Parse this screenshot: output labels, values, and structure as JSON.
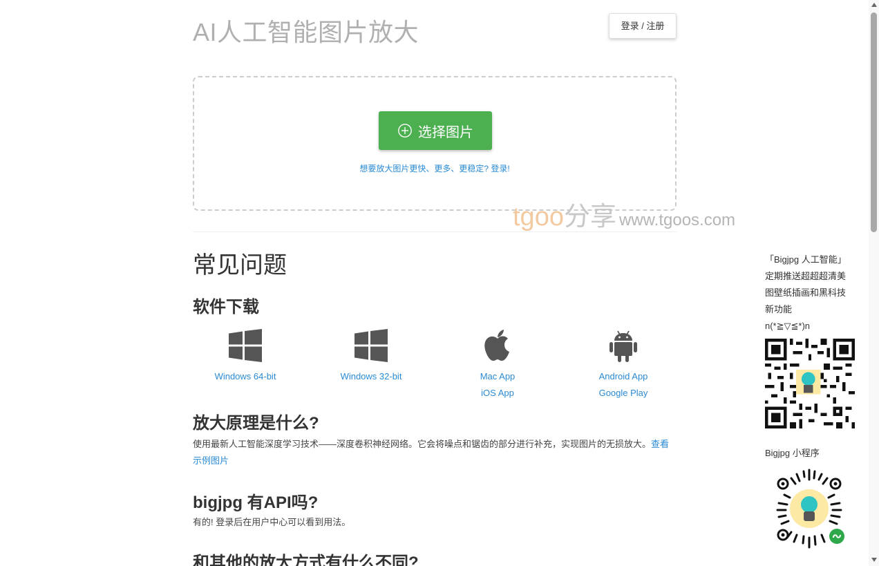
{
  "header": {
    "title": "AI人工智能图片放大",
    "login_label": "登录 / 注册"
  },
  "upload": {
    "choose_label": "选择图片",
    "upgrade_text": "想要放大图片更快、更多、更稳定? 登录!"
  },
  "watermark": {
    "logo": "tgoo",
    "text": "分享",
    "url": "www.tgoos.com"
  },
  "faq": {
    "title": "常见问题",
    "download_title": "软件下载",
    "downloads": [
      {
        "icon": "windows-icon",
        "links": [
          "Windows 64-bit"
        ]
      },
      {
        "icon": "windows-icon",
        "links": [
          "Windows 32-bit"
        ]
      },
      {
        "icon": "apple-icon",
        "links": [
          "Mac App",
          "iOS App"
        ]
      },
      {
        "icon": "android-icon",
        "links": [
          "Android App",
          "Google Play"
        ]
      }
    ],
    "q1_title": "放大原理是什么?",
    "q1_text": "使用最新人工智能深度学习技术——深度卷积神经网络。它会将噪点和锯齿的部分进行补充，实现图片的无损放大。",
    "q1_link": "查看示例图片",
    "q2_title": "bigjpg 有API吗?",
    "q2_text": "有的! 登录后在用户中心可以看到用法。",
    "q3_title": "和其他的放大方式有什么不同?"
  },
  "sidebar": {
    "lines": [
      "「Bigjpg 人工智能」",
      "定期推送超超超清美",
      "图壁纸插画和黑科技",
      "新功能",
      "n(*≧▽≦*)n"
    ],
    "mini_program_title": "Bigjpg 小程序"
  },
  "colors": {
    "accent_green": "#4caf50",
    "link_blue": "#2a8ad4",
    "title_gray": "#b0b0b0"
  }
}
